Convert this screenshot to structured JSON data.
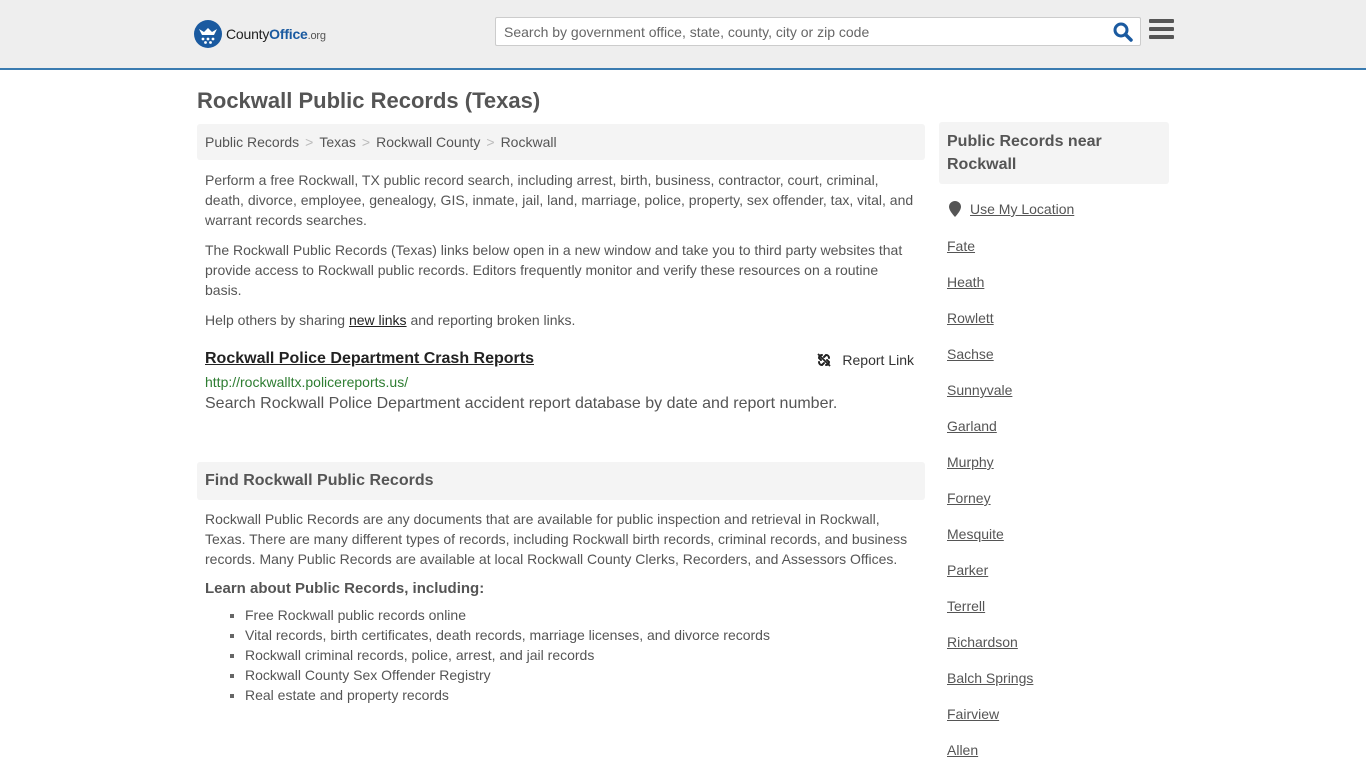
{
  "header": {
    "logo": {
      "brand_part1": "County",
      "brand_part2": "Office",
      "brand_tld": ".org"
    },
    "search": {
      "placeholder": "Search by government office, state, county, city or zip code",
      "value": ""
    },
    "icons": {
      "search": "search-icon",
      "menu": "hamburger-menu-icon"
    },
    "accent_color": "#3a7bb0"
  },
  "page_title": "Rockwall Public Records (Texas)",
  "breadcrumb": [
    "Public Records",
    "Texas",
    "Rockwall County",
    "Rockwall"
  ],
  "intro": {
    "p1": "Perform a free Rockwall, TX public record search, including arrest, birth, business, contractor, court, criminal, death, divorce, employee, genealogy, GIS, inmate, jail, land, marriage, police, property, sex offender, tax, vital, and warrant records searches.",
    "p2": "The Rockwall Public Records (Texas) links below open in a new window and take you to third party websites that provide access to Rockwall public records. Editors frequently monitor and verify these resources on a routine basis.",
    "p3_before": "Help others by sharing ",
    "p3_link": "new links",
    "p3_after": " and reporting broken links."
  },
  "links": [
    {
      "title": "Rockwall Police Department Crash Reports",
      "url": "http://rockwalltx.policereports.us/",
      "description": "Search Rockwall Police Department accident report database by date and report number.",
      "report_label": "Report Link"
    }
  ],
  "find_section": {
    "heading": "Find Rockwall Public Records",
    "body": "Rockwall Public Records are any documents that are available for public inspection and retrieval in Rockwall, Texas. There are many different types of records, including Rockwall birth records, criminal records, and business records. Many Public Records are available at local Rockwall County Clerks, Recorders, and Assessors Offices.",
    "learn_heading": "Learn about Public Records, including:",
    "items": [
      "Free Rockwall public records online",
      "Vital records, birth certificates, death records, marriage licenses, and divorce records",
      "Rockwall criminal records, police, arrest, and jail records",
      "Rockwall County Sex Offender Registry",
      "Real estate and property records"
    ]
  },
  "sidebar": {
    "heading": "Public Records near Rockwall",
    "use_location": "Use My Location",
    "nearby": [
      "Fate",
      "Heath",
      "Rowlett",
      "Sachse",
      "Sunnyvale",
      "Garland",
      "Murphy",
      "Forney",
      "Mesquite",
      "Parker",
      "Terrell",
      "Richardson",
      "Balch Springs",
      "Fairview",
      "Allen"
    ]
  }
}
